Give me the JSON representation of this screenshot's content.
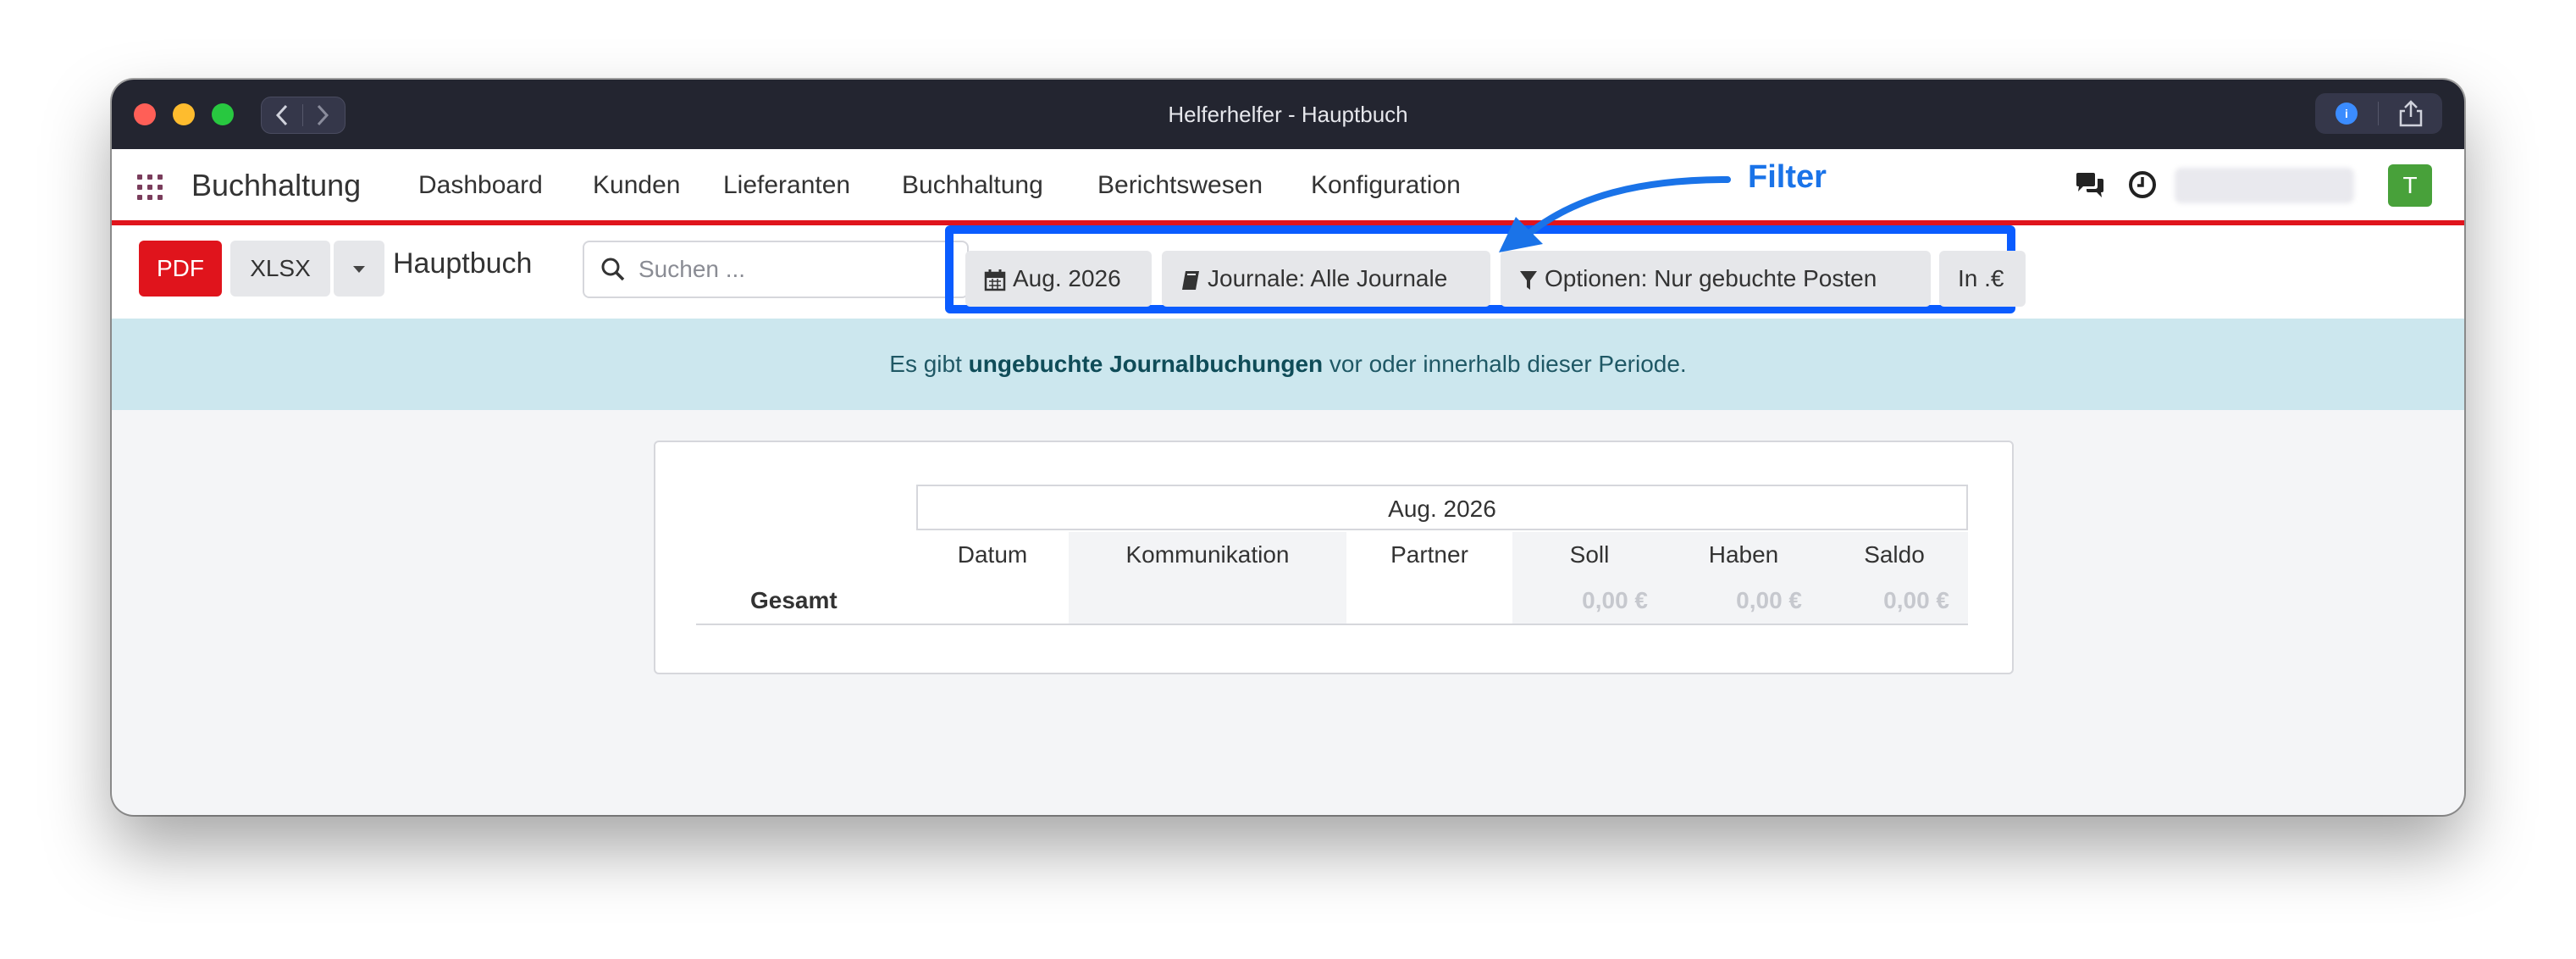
{
  "window": {
    "title": "Helferhelfer - Hauptbuch"
  },
  "topnav": {
    "brand": "Buchhaltung",
    "menu": [
      {
        "label": "Dashboard"
      },
      {
        "label": "Kunden"
      },
      {
        "label": "Lieferanten"
      },
      {
        "label": "Buchhaltung"
      },
      {
        "label": "Berichtswesen"
      },
      {
        "label": "Konfiguration"
      }
    ],
    "avatar_initial": "T"
  },
  "controlbar": {
    "pdf_label": "PDF",
    "xlsx_label": "XLSX",
    "breadcrumb": "Hauptbuch",
    "search_placeholder": "Suchen ..."
  },
  "filters": [
    {
      "icon": "calendar-icon",
      "label": "Aug. 2026"
    },
    {
      "icon": "book-icon",
      "label": "Journale: Alle Journale"
    },
    {
      "icon": "filter-icon",
      "label": "Optionen: Nur gebuchte Posten"
    },
    {
      "icon": "",
      "label": "In .€"
    }
  ],
  "alert": {
    "prefix": "Es gibt ",
    "link": "ungebuchte Journalbuchungen",
    "suffix": " vor oder innerhalb dieser Periode."
  },
  "report": {
    "period": "Aug. 2026",
    "columns": [
      "Datum",
      "Kommunikation",
      "Partner",
      "Soll",
      "Haben",
      "Saldo"
    ],
    "total_label": "Gesamt",
    "totals": {
      "soll": "0,00 €",
      "haben": "0,00 €",
      "saldo": "0,00 €"
    }
  },
  "annotation": {
    "label": "Filter",
    "color": "#1a73e8"
  },
  "colors": {
    "accent_red": "#e0141c",
    "annotation_blue": "#0a5cff",
    "avatar_green": "#48a13a",
    "alert_bg": "#cce7ee"
  }
}
